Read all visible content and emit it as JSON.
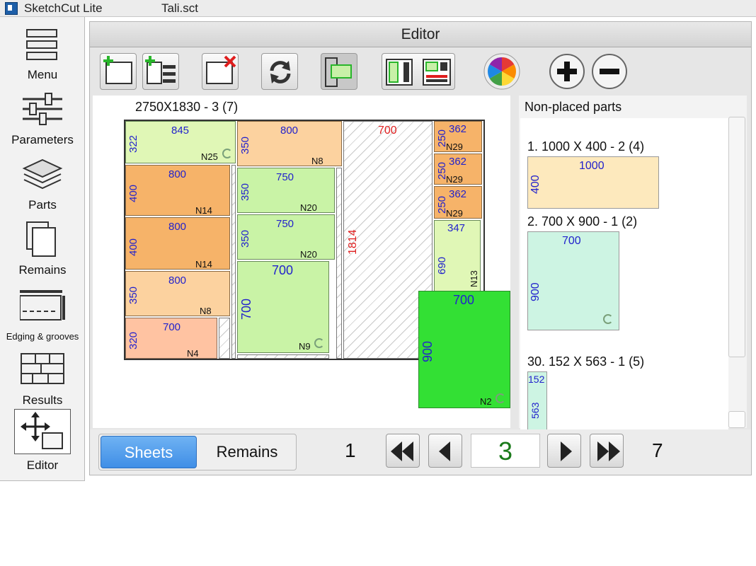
{
  "titlebar": {
    "app_title": "SketchCut Lite",
    "file_title": "Tali.sct"
  },
  "sidebar": {
    "items": [
      {
        "label": "Menu"
      },
      {
        "label": "Parameters"
      },
      {
        "label": "Parts"
      },
      {
        "label": "Remains"
      },
      {
        "label": "Edging & grooves"
      },
      {
        "label": "Results"
      },
      {
        "label": "Editor"
      }
    ]
  },
  "editor": {
    "title": "Editor",
    "toolbar": [
      "add-sheet-icon",
      "add-sheet-list-icon",
      "delete-sheet-icon",
      "rotate-icon",
      "layout-icon",
      "split-layout-icon",
      "color-wheel-icon",
      "zoom-in-icon",
      "zoom-out-icon"
    ]
  },
  "sheet": {
    "title": "2750X1830 - 3 (7)",
    "parts": [
      {
        "w": "845",
        "h": "322",
        "n": "N25"
      },
      {
        "w": "800",
        "h": "350",
        "n": "N8"
      },
      {
        "w": "700",
        "h": "1814"
      },
      {
        "w": "362",
        "h": "250",
        "n": "N29"
      },
      {
        "w": "362",
        "h": "250",
        "n": "N29"
      },
      {
        "w": "362",
        "h": "250",
        "n": "N29"
      },
      {
        "w": "800",
        "h": "400",
        "n": "N14"
      },
      {
        "w": "750",
        "h": "350",
        "n": "N20"
      },
      {
        "w": "800",
        "h": "400",
        "n": "N14"
      },
      {
        "w": "750",
        "h": "350",
        "n": "N20"
      },
      {
        "w": "347",
        "h": "690",
        "n": "N13"
      },
      {
        "w": "700",
        "h": "700",
        "n": "N9"
      },
      {
        "w": "800",
        "h": "350",
        "n": "N8"
      },
      {
        "w": "700",
        "h": "320",
        "n": "N4"
      },
      {
        "w": "700",
        "h": "900",
        "n": "N2"
      }
    ]
  },
  "non_placed": {
    "title": "Non-placed parts",
    "items": [
      {
        "label": "1. 1000 X 400 - 2 (4)",
        "w": "1000",
        "h": "400"
      },
      {
        "label": "2. 700 X 900 - 1 (2)",
        "w": "700",
        "h": "900"
      },
      {
        "label": "30. 152 X 563 - 1 (5)",
        "w": "152",
        "h": "563"
      }
    ]
  },
  "bottom": {
    "sheets_label": "Sheets",
    "remains_label": "Remains",
    "first_page": "1",
    "current_page": "3",
    "last_page": "7"
  }
}
